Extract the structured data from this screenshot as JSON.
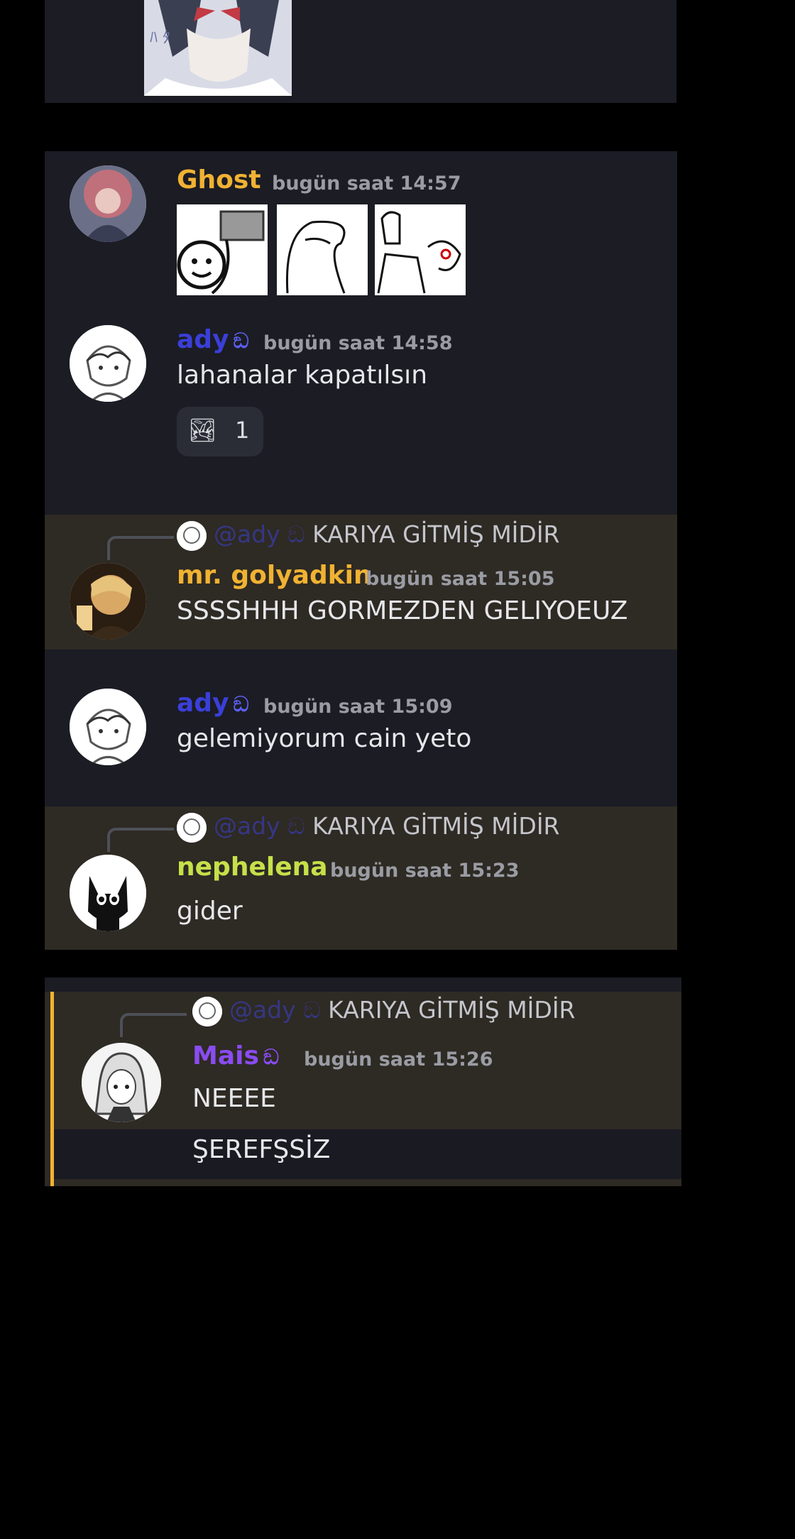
{
  "colors": {
    "panel_bg": "#1b1c24",
    "highlight_bg": "#2e2a24",
    "mention_bar": "#f0b232",
    "ghost_name": "#f0b232",
    "ady_name": "#3a3fd8",
    "golyadkin_name": "#f0b232",
    "nephelena_name": "#c6e04a",
    "mais_name": "#8a4cf0"
  },
  "messages": [
    {
      "author": "Ghost",
      "timestamp": "bugün saat 14:57",
      "stickers": [
        "teapot-face-sticker",
        "blob-sketch-sticker",
        "pointing-sketch-sticker"
      ]
    },
    {
      "author": "ady",
      "badge": "ඞ",
      "timestamp": "bugün saat 14:58",
      "text": "lahanalar kapatılsın",
      "reaction": {
        "emoji": "🏞",
        "count": "1"
      }
    },
    {
      "reply_to": {
        "mention": "@ady",
        "text": "KARIYA GİTMİŞ MİDİR"
      },
      "author": "mr. golyadkin",
      "timestamp": "bugün saat 15:05",
      "text": "SSSSHHH GORMEZDEN GELIYOEUZ"
    },
    {
      "author": "ady",
      "badge": "ඞ",
      "timestamp": "bugün saat 15:09",
      "text": "gelemiyorum cain yeto"
    },
    {
      "reply_to": {
        "mention": "@ady",
        "text": "KARIYA GİTMİŞ MİDİR"
      },
      "author": "nephelena",
      "timestamp": "bugün saat 15:23",
      "text": "gider"
    },
    {
      "reply_to": {
        "mention": "@ady",
        "text": "KARIYA GİTMİŞ MİDİR"
      },
      "author": "Mais",
      "badge": "ඞ",
      "timestamp": "bugün saat 15:26",
      "text": "NEEEE",
      "followup": "ŞEREFŞSİZ"
    }
  ]
}
